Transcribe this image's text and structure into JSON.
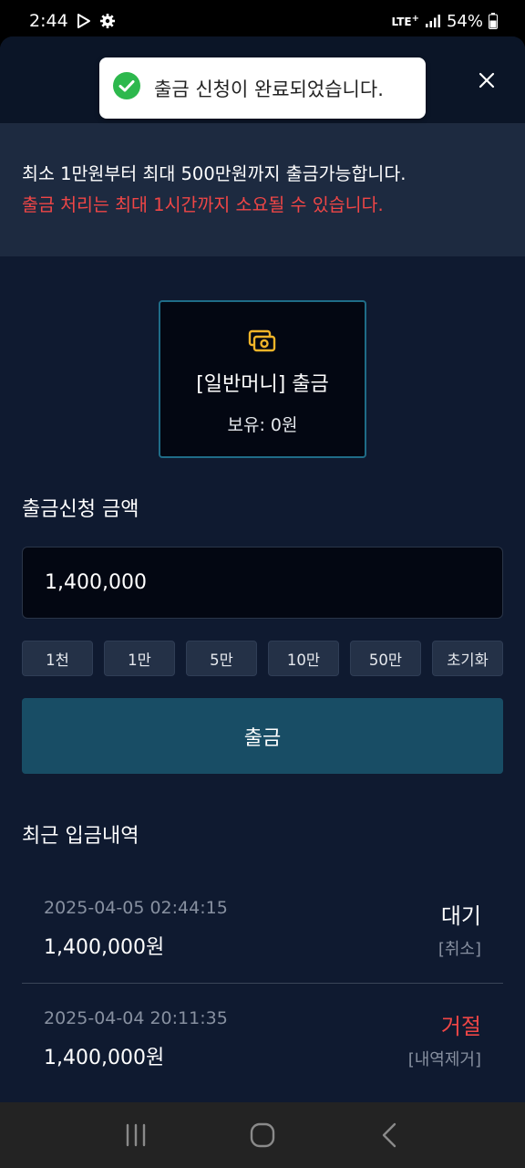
{
  "status_bar": {
    "time": "2:44",
    "network": "LTE",
    "network_plus": "+",
    "battery": "54%"
  },
  "toast": {
    "message": "출금 신청이 완료되었습니다."
  },
  "notice": {
    "line1": "최소 1만원부터 최대 500만원까지 출금가능합니다.",
    "line2": "출금 처리는 최대 1시간까지 소요될 수 있습니다."
  },
  "wallet": {
    "title": "[일반머니] 출금",
    "balance": "보유: 0원"
  },
  "form": {
    "amount_label": "출금신청 금액",
    "amount_value": "1,400,000",
    "quick_buttons": [
      "1천",
      "1만",
      "5만",
      "10만",
      "50만",
      "초기화"
    ],
    "submit_label": "출금"
  },
  "history": {
    "title": "최근 입금내역",
    "items": [
      {
        "date": "2025-04-05 02:44:15",
        "amount": "1,400,000원",
        "status": "대기",
        "action": "[취소]"
      },
      {
        "date": "2025-04-04 20:11:35",
        "amount": "1,400,000원",
        "status": "거절",
        "action": "[내역제거]"
      }
    ]
  },
  "colors": {
    "background": "#0f1a30",
    "accent_button": "#184d65",
    "warning": "#ef4646",
    "wallet_icon": "#f0b429",
    "toast_check": "#2db84d"
  },
  "icons": {
    "status_left": [
      "play-store-icon",
      "gear-icon"
    ],
    "status_right": [
      "signal-icon",
      "battery-icon"
    ],
    "toast": "check-circle-icon",
    "close": "close-icon",
    "wallet": "money-icon",
    "nav": [
      "recents-icon",
      "home-icon",
      "back-icon"
    ]
  }
}
